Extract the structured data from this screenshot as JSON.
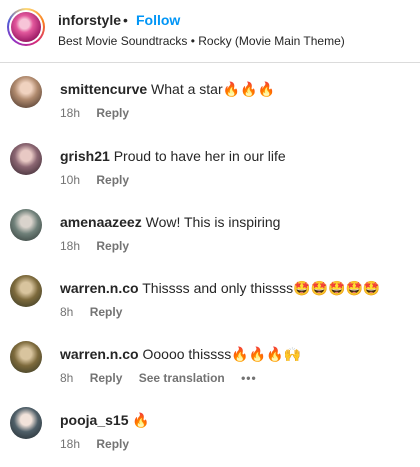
{
  "header": {
    "author": "inforstyle",
    "separator": "•",
    "follow_label": "Follow",
    "subtitle": "Best Movie Soundtracks • Rocky (Movie Main Theme)"
  },
  "comments": [
    {
      "username": "smittencurve",
      "text": "What a star",
      "emoji": "🔥🔥🔥",
      "time": "18h",
      "reply_label": "Reply",
      "avatar_color": "#b08a6e"
    },
    {
      "username": "grish21",
      "text": "Proud to have her in our life",
      "emoji": "",
      "time": "10h",
      "reply_label": "Reply",
      "avatar_color": "#7a5a66"
    },
    {
      "username": "amenaazeez",
      "text": "Wow! This is inspiring",
      "emoji": "",
      "time": "18h",
      "reply_label": "Reply",
      "avatar_color": "#6f8079"
    },
    {
      "username": "warren.n.co",
      "text": "Thissss and only thissss",
      "emoji": "🤩🤩🤩🤩🤩",
      "time": "8h",
      "reply_label": "Reply",
      "avatar_color": "#5e6a4c"
    },
    {
      "username": "warren.n.co",
      "text": "Ooooo thissss",
      "emoji": "🔥🔥🔥🙌",
      "time": "8h",
      "reply_label": "Reply",
      "translate_label": "See translation",
      "more_label": "•••",
      "avatar_color": "#5e6a4c"
    },
    {
      "username": "pooja_s15",
      "text": "",
      "emoji": "🔥",
      "time": "18h",
      "reply_label": "Reply",
      "avatar_color": "#3f4e57"
    }
  ]
}
